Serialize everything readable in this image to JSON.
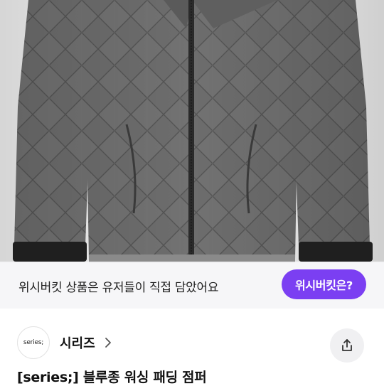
{
  "banner": {
    "text": "위시버킷 상품은 유저들이 직접 담았어요",
    "button_label": "위시버킷은?"
  },
  "shop": {
    "logo_text": "series;",
    "name": "시리즈"
  },
  "product": {
    "title": "[series;] 블루종 워싱 패딩 점퍼"
  },
  "colors": {
    "accent": "#7b3ff2",
    "jacket": "#6b6b6b"
  },
  "icons": {
    "shop_chevron": "chevron-right-icon",
    "share": "share-icon"
  }
}
